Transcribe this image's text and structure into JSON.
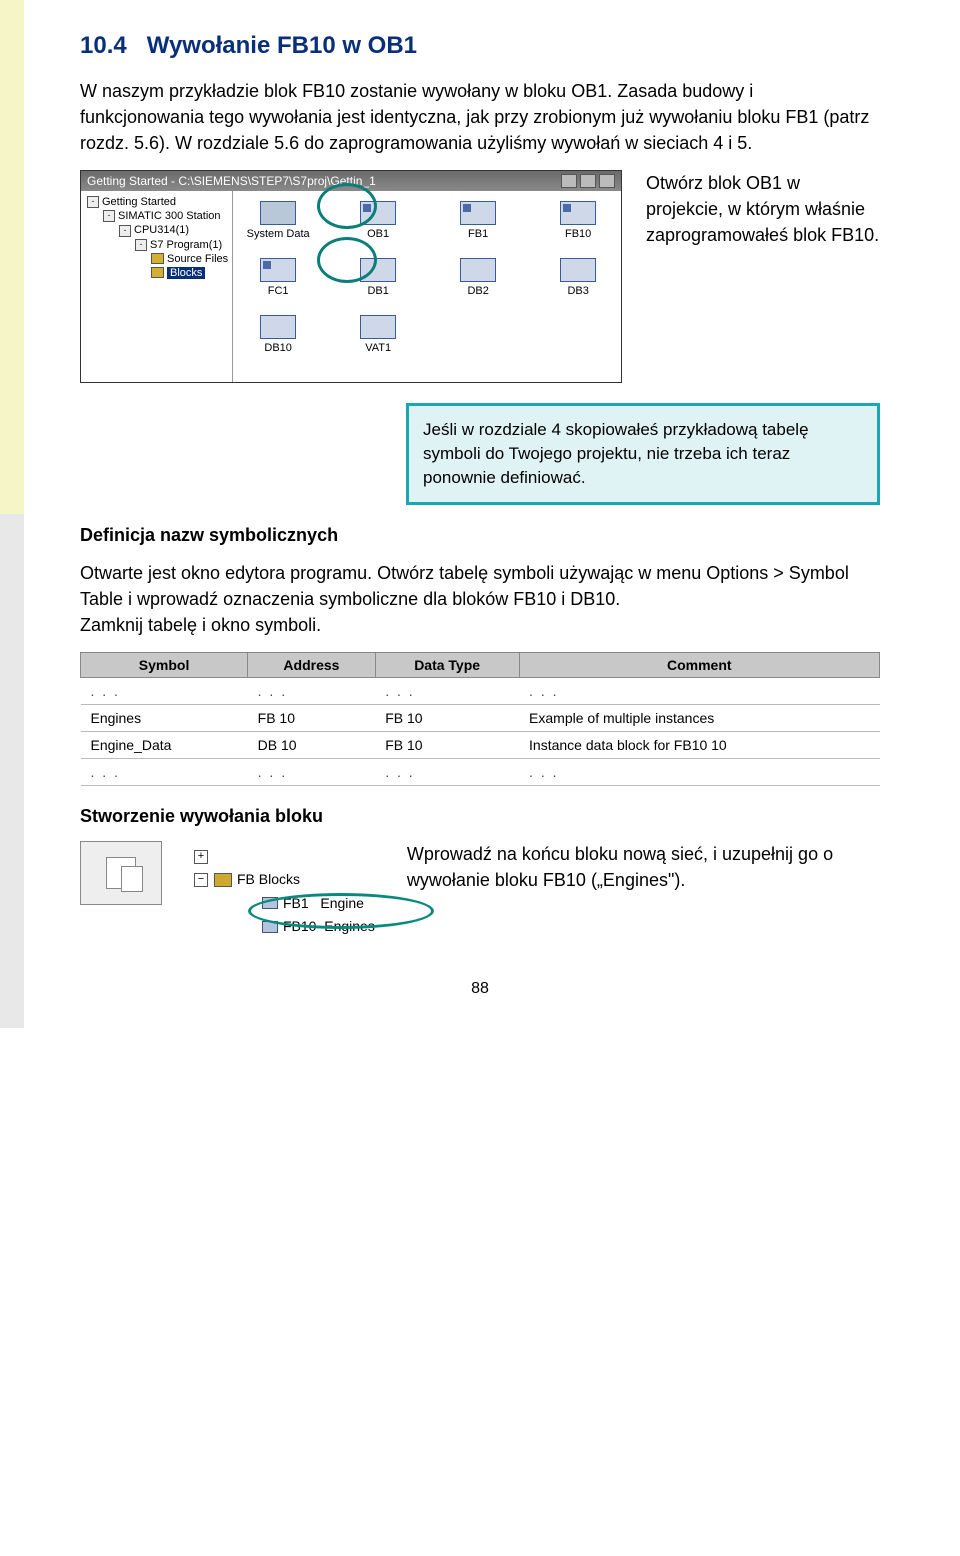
{
  "section": {
    "number": "10.4",
    "title": "Wywołanie FB10 w OB1"
  },
  "intro": "W naszym przykładzie blok FB10 zostanie wywołany w bloku OB1. Zasada budowy i funkcjonowania tego wywołania jest identyczna, jak przy zrobionym już wywołaniu bloku FB1 (patrz rozdz. 5.6). W rozdziale 5.6 do zaprogramowania użyliśmy wywołań w sieciach 4 i 5.",
  "proj_window": {
    "title": "Getting Started - C:\\SIEMENS\\STEP7\\S7proj\\Gettin_1",
    "tree": {
      "root": "Getting Started",
      "station": "SIMATIC 300 Station",
      "cpu": "CPU314(1)",
      "program": "S7 Program(1)",
      "sources": "Source Files",
      "blocks": "Blocks"
    },
    "row1": [
      "System Data",
      "OB1",
      "FB1",
      "FB10"
    ],
    "row2": [
      "FC1",
      "DB1",
      "DB2",
      "DB3"
    ],
    "row3": [
      "DB10",
      "VAT1"
    ]
  },
  "open_ob1_text": "Otwórz blok OB1 w projekcie, w którym właśnie zaprogramowałeś blok FB10.",
  "callout": "Jeśli w rozdziale 4 skopiowałeś przykładową tabelę symboli do Twojego projektu, nie trzeba ich teraz ponownie definiować.",
  "def_heading": "Definicja nazw symbolicznych",
  "def_para": "Otwarte jest okno edytora programu. Otwórz tabelę symboli używając w menu Options > Symbol Table i wprowadź oznaczenia symboliczne dla bloków FB10 i DB10.\nZamknij tabelę i okno symboli.",
  "sym_table": {
    "headers": [
      "Symbol",
      "Address",
      "Data Type",
      "Comment"
    ],
    "rows": [
      {
        "symbol": ". . .",
        "address": ". . .",
        "datatype": ". . .",
        "comment": ". . ."
      },
      {
        "symbol": "Engines",
        "address": "FB    10",
        "datatype": "FB    10",
        "comment": "Example of multiple instances"
      },
      {
        "symbol": "Engine_Data",
        "address": "DB    10",
        "datatype": "FB    10",
        "comment": "Instance data block for FB10 10"
      },
      {
        "symbol": ". . .",
        "address": ". . .",
        "datatype": ". . .",
        "comment": ". . ."
      }
    ]
  },
  "create_heading": "Stworzenie wywołania bloku",
  "fb_tree": {
    "folder": "FB Blocks",
    "fb1": "FB1",
    "fb1_label": "Engine",
    "fb10": "FB10",
    "fb10_label": "Engines"
  },
  "create_side": "Wprowadź na końcu bloku nową sieć, i uzupełnij go o wywołanie bloku FB10 („Engines\").",
  "page_number": "88"
}
